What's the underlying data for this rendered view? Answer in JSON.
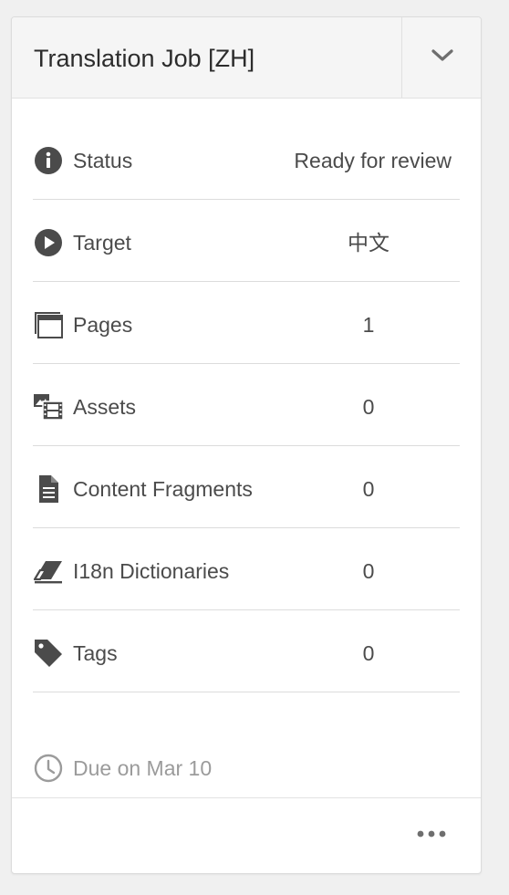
{
  "card": {
    "title": "Translation Job [ZH]",
    "toggle_icon": "chevron-down-icon",
    "more_icon": "more-horizontal-icon"
  },
  "rows": [
    {
      "icon": "info-icon",
      "label": "Status",
      "value": "Ready for review"
    },
    {
      "icon": "play-icon",
      "label": "Target",
      "value": "中文"
    },
    {
      "icon": "pages-icon",
      "label": "Pages",
      "value": "1"
    },
    {
      "icon": "assets-icon",
      "label": "Assets",
      "value": "0"
    },
    {
      "icon": "document-icon",
      "label": "Content Fragments",
      "value": "0"
    },
    {
      "icon": "eraser-icon",
      "label": "I18n Dictionaries",
      "value": "0"
    },
    {
      "icon": "tag-icon",
      "label": "Tags",
      "value": "0"
    }
  ],
  "due": {
    "icon": "clock-icon",
    "text": "Due on Mar 10"
  },
  "colors": {
    "text": "#4b4b4b",
    "muted": "#9b9b9b",
    "divider": "#dcdcdc",
    "header_bg": "#f5f5f5"
  }
}
